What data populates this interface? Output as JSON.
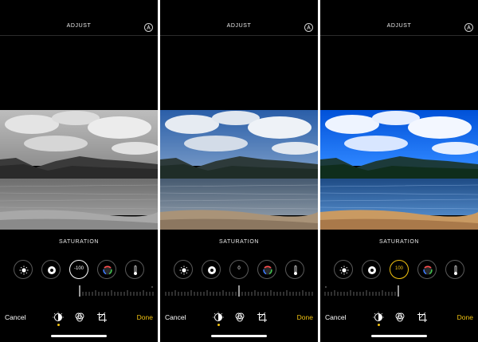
{
  "panels": [
    {
      "title": "ADJUST",
      "section_label": "SATURATION",
      "saturation_value": "-100",
      "cancel_label": "Cancel",
      "done_label": "Done",
      "photo_style": "grayscale"
    },
    {
      "title": "ADJUST",
      "section_label": "SATURATION",
      "saturation_value": "0",
      "cancel_label": "Cancel",
      "done_label": "Done",
      "photo_style": "normal"
    },
    {
      "title": "ADJUST",
      "section_label": "SATURATION",
      "saturation_value": "100",
      "cancel_label": "Cancel",
      "done_label": "Done",
      "photo_style": "vivid"
    }
  ],
  "icons": {
    "auto": "auto-enhance-icon",
    "brightness": "brightness-icon",
    "exposure": "exposure-icon",
    "saturation": "saturation-dial",
    "vibrance": "vibrance-icon",
    "warmth": "warmth-icon",
    "adjust_mode": "adjust-mode-icon",
    "filters_mode": "filters-mode-icon",
    "crop_mode": "crop-mode-icon"
  },
  "colors": {
    "accent": "#f3c310",
    "background": "#000000"
  }
}
